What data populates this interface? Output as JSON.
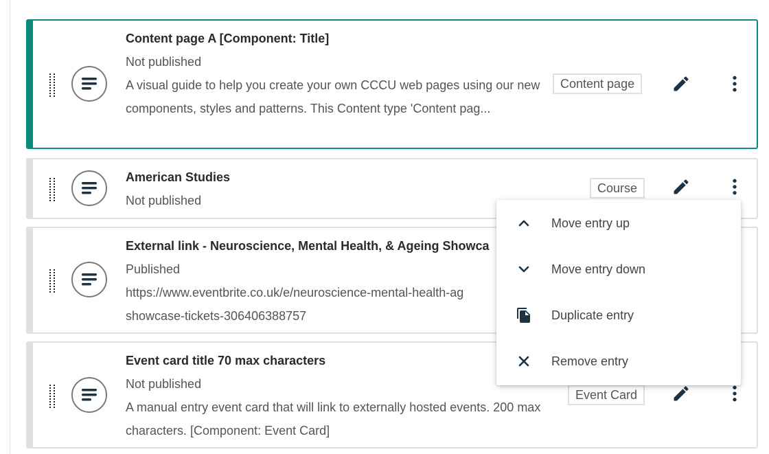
{
  "entries": [
    {
      "title": "Content page A [Component: Title]",
      "status": "Not published",
      "description": "A visual guide to help you create your own CCCU web pages using our new components, styles and patterns. This Content type 'Content pag...",
      "type": "Content page",
      "selected": true
    },
    {
      "title": "American Studies",
      "status": "Not published",
      "description": "",
      "type": "Course",
      "selected": false
    },
    {
      "title": "External link - Neuroscience, Mental Health, & Ageing Showca",
      "status": "Published",
      "description": "https://www.eventbrite.co.uk/e/neuroscience-mental-health-ag showcase-tickets-306406388757",
      "type": "",
      "selected": false
    },
    {
      "title": "Event card title 70 max characters",
      "status": "Not published",
      "description": "A manual entry event card that will link to externally hosted events. 200 max characters. [Component: Event Card]",
      "type": "Event Card",
      "selected": false
    }
  ],
  "menu": {
    "items": [
      {
        "label": "Move entry up",
        "icon": "chevron-up-icon"
      },
      {
        "label": "Move entry down",
        "icon": "chevron-down-icon"
      },
      {
        "label": "Duplicate entry",
        "icon": "duplicate-icon"
      },
      {
        "label": "Remove entry",
        "icon": "close-icon"
      }
    ]
  },
  "colors": {
    "selected_border": "#0e8a79",
    "card_border": "#e0e0e0",
    "icon_dark": "#1d3343"
  }
}
